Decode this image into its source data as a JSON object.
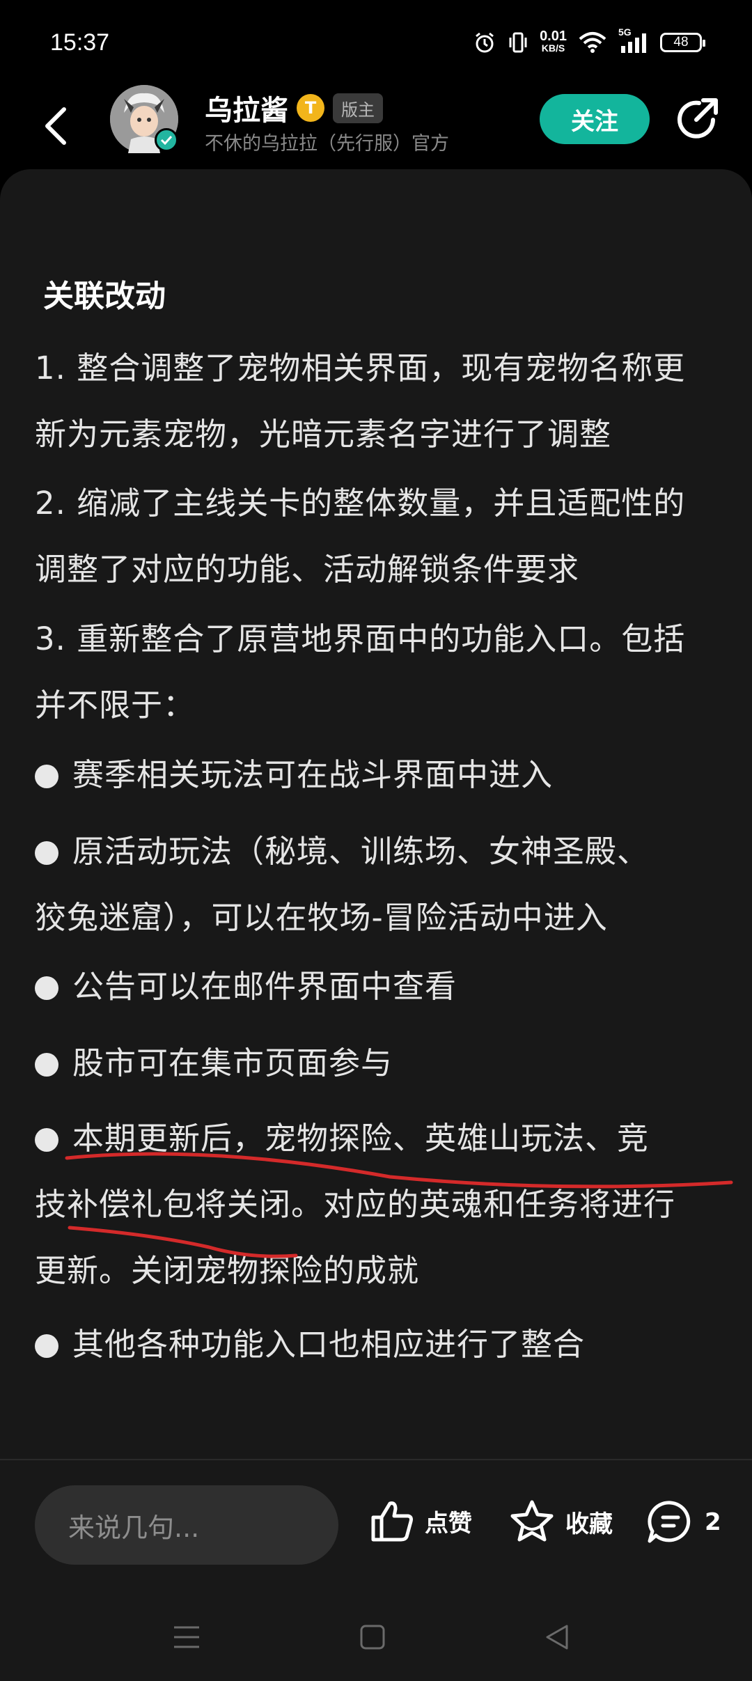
{
  "status_bar": {
    "time": "15:37",
    "net_speed_value": "0.01",
    "net_speed_unit": "KB/S",
    "network_type": "5G",
    "battery": "48"
  },
  "header": {
    "author_name": "乌拉酱",
    "level_badge": "T",
    "role_badge": "版主",
    "author_subtitle": "不休的乌拉拉（先行服）官方",
    "follow_label": "关注"
  },
  "content": {
    "section_title": "关联改动",
    "item1_line1": "1. 整合调整了宠物相关界面，现有宠物名称更",
    "item1_line2": "新为元素宠物，光暗元素名字进行了调整",
    "item2_line1": "2. 缩减了主线关卡的整体数量，并且适配性的",
    "item2_line2": "调整了对应的功能、活动解锁条件要求",
    "item3_line1": "3. 重新整合了原营地界面中的功能入口。包括",
    "item3_line2": "并不限于：",
    "bullet1": "赛季相关玩法可在战斗界面中进入",
    "bullet2_line1": "原活动玩法（秘境、训练场、女神圣殿、",
    "bullet2_line2": "狡兔迷窟），可以在牧场-冒险活动中进入",
    "bullet3": "公告可以在邮件界面中查看",
    "bullet4": "股市可在集市页面参与",
    "bullet5_line1": "本期更新后，宠物探险、英雄山玩法、竞",
    "bullet5_line2": "技补偿礼包将关闭。对应的英魂和任务将进行",
    "bullet5_line3": "更新。关闭宠物探险的成就",
    "bullet6": "其他各种功能入口也相应进行了整合"
  },
  "bottom_bar": {
    "comment_placeholder": "来说几句...",
    "like_label": "点赞",
    "favorite_label": "收藏",
    "comment_count": "2"
  },
  "colors": {
    "accent": "#13b59c",
    "annotation_red": "#d42a2a",
    "background": "#181818"
  }
}
